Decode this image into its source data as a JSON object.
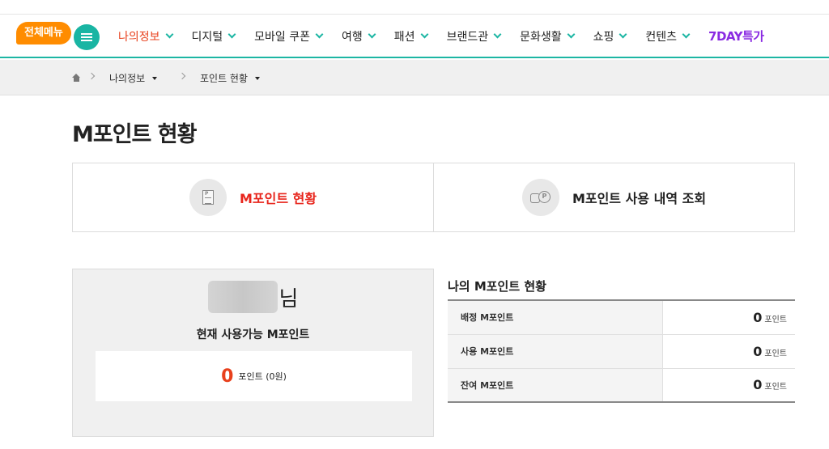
{
  "gnb": {
    "allmenu_label": "전체메뉴",
    "menu": [
      {
        "label": "나의정보",
        "active": true
      },
      {
        "label": "디지털"
      },
      {
        "label": "모바일 쿠폰"
      },
      {
        "label": "여행"
      },
      {
        "label": "패션"
      },
      {
        "label": "브랜드관"
      },
      {
        "label": "문화생활"
      },
      {
        "label": "쇼핑"
      },
      {
        "label": "컨텐츠"
      }
    ],
    "special_label": "7DAY특가"
  },
  "breadcrumb": {
    "level1": "나의정보",
    "level2": "포인트 현황"
  },
  "page_title": "M포인트 현황",
  "tabs": [
    {
      "label": "M포인트 현황",
      "icon": "point-document-icon",
      "active": true
    },
    {
      "label": "M포인트 사용 내역 조회",
      "icon": "coins-icon",
      "active": false
    }
  ],
  "balance": {
    "name_suffix": "님",
    "available_label": "현재 사용가능 M포인트",
    "available_value": "0",
    "available_unit": "포인트 (0원)"
  },
  "status": {
    "title": "나의 M포인트 현황",
    "rows": [
      {
        "label": "배정 M포인트",
        "value": "0",
        "unit": "포인트"
      },
      {
        "label": "사용 M포인트",
        "value": "0",
        "unit": "포인트"
      },
      {
        "label": "잔여 M포인트",
        "value": "0",
        "unit": "포인트"
      }
    ]
  },
  "colors": {
    "accent_teal": "#1cb6a3",
    "badge_orange": "#ff8c00",
    "active_red": "#e8251c",
    "special_purple": "#8a2be2"
  }
}
